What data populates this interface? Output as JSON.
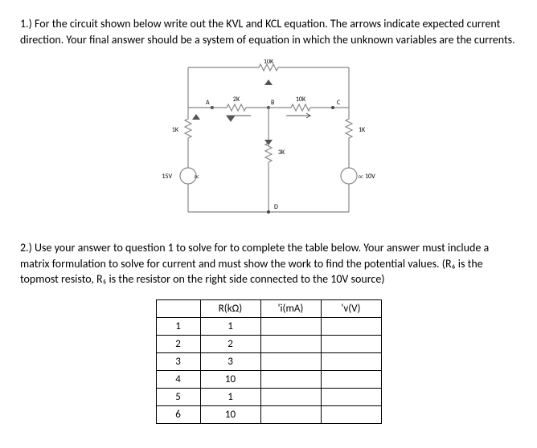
{
  "q1": {
    "text": "1.) For the circuit shown below write out the KVL and KCL equation. The arrows indicate expected current direction. Your final answer should be a system of equation in which the unknown variables are the currents."
  },
  "circuit": {
    "r_top": "10K",
    "r_ab": "2K",
    "r_bc": "10K",
    "r_left": "1K",
    "r_mid": "3K",
    "r_right": "1K",
    "v_left": "15V",
    "v_right": "10V",
    "dc_left": "DC",
    "dc_right": "DC",
    "node_a": "A",
    "node_b": "B",
    "node_c": "C",
    "node_d": "D"
  },
  "q2": {
    "text": "2.) Use your answer to question 1 to solve for to complete the table below. Your answer must include a matrix formulation to solve for current and must show the work to find the potential values. (R₆ is the topmost resisto, R₅ is the resistor on the right side connected to the 10V source)"
  },
  "table": {
    "headers": [
      "R(kΩ)",
      "'i(mA)",
      "'v(V)"
    ],
    "rows": [
      {
        "n": "1",
        "r": "1",
        "i": "",
        "v": ""
      },
      {
        "n": "2",
        "r": "2",
        "i": "",
        "v": ""
      },
      {
        "n": "3",
        "r": "3",
        "i": "",
        "v": ""
      },
      {
        "n": "4",
        "r": "10",
        "i": "",
        "v": ""
      },
      {
        "n": "5",
        "r": "1",
        "i": "",
        "v": ""
      },
      {
        "n": "6",
        "r": "10",
        "i": "",
        "v": ""
      }
    ]
  }
}
